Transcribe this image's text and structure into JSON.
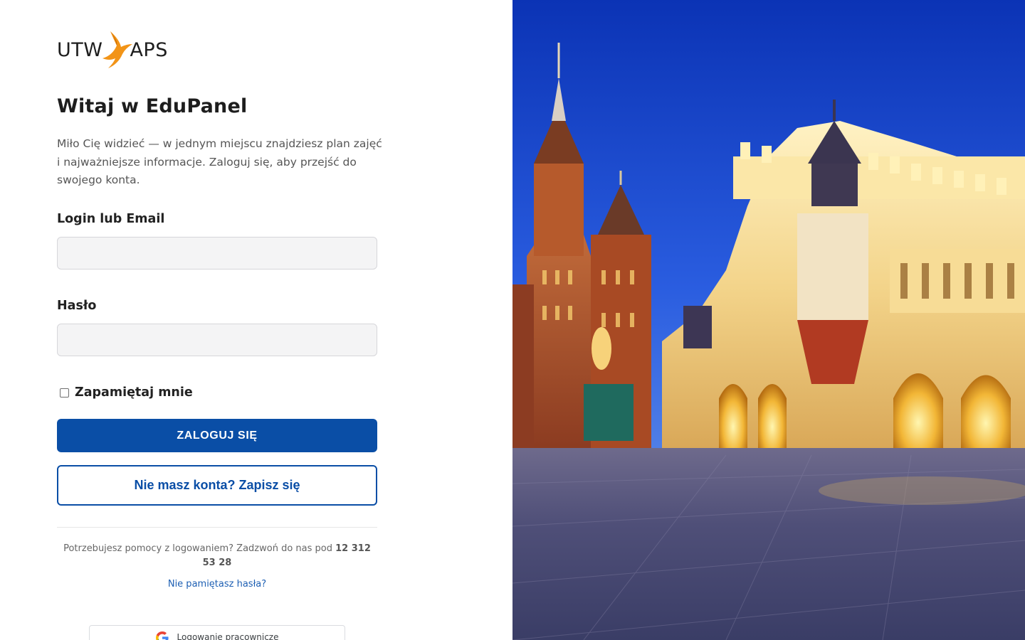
{
  "brand": {
    "logo_left": "UTW",
    "logo_right": "APS",
    "accent_color": "#f39c12"
  },
  "login": {
    "title": "Witaj w EduPanel",
    "intro": "Miło Cię widzieć — w jednym miejscu znajdziesz plan zajęć i najważniejsze informacje. Zaloguj się, aby przejść do swojego konta.",
    "login_label": "Login lub Email",
    "login_value": "",
    "password_label": "Hasło",
    "password_value": "",
    "remember_label": "Zapamiętaj mnie",
    "submit_label": "ZALOGUJ SIĘ",
    "signup_label": "Nie masz konta? Zapisz się",
    "help_text": "Potrzebujesz pomocy z logowaniem? Zadzwoń do nas pod",
    "help_phone": "12 312 53 28",
    "forgot_label": "Nie pamiętasz hasła?",
    "google_label": "Logowanie pracownicze"
  },
  "colors": {
    "primary": "#0a4ea6",
    "link": "#1d5fb3"
  },
  "hero": {
    "image_icon": "old-town-square-photo"
  }
}
